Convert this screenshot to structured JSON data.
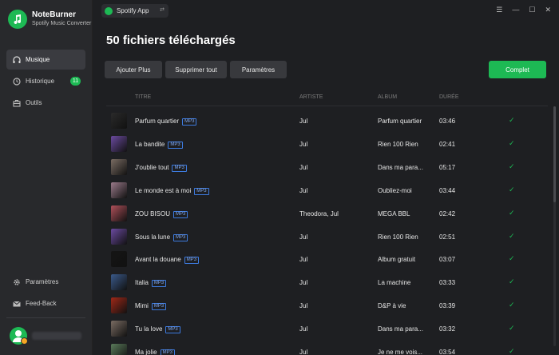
{
  "brand": {
    "name": "NoteBurner",
    "subtitle": "Spotify Music Converter"
  },
  "sidebar": {
    "items": [
      {
        "label": "Musique",
        "icon": "headphones-icon",
        "active": true
      },
      {
        "label": "Historique",
        "icon": "clock-icon",
        "badge": "11"
      },
      {
        "label": "Outils",
        "icon": "toolbox-icon"
      }
    ],
    "bottom": [
      {
        "label": "Paramètres",
        "icon": "gear-icon"
      },
      {
        "label": "Feed-Back",
        "icon": "mail-icon"
      }
    ]
  },
  "app_tab": {
    "label": "Spotify App"
  },
  "title": "50 fichiers téléchargés",
  "toolbar": {
    "add_label": "Ajouter Plus",
    "delete_all_label": "Supprimer tout",
    "settings_label": "Paramètres",
    "complete_label": "Complet"
  },
  "table": {
    "headers": {
      "title": "TITRE",
      "artist": "ARTISTE",
      "album": "ALBUM",
      "duration": "DURÉE"
    },
    "format_badge": "MP3",
    "rows": [
      {
        "title": "Parfum quartier",
        "artist": "Jul",
        "album": "Parfum quartier",
        "duration": "03:46",
        "cover": "#2a2a2a"
      },
      {
        "title": "La bandite",
        "artist": "Jul",
        "album": "Rien 100 Rien",
        "duration": "02:41",
        "cover": "#6b4aa0"
      },
      {
        "title": "J'oublie tout",
        "artist": "Jul",
        "album": "Dans ma para...",
        "duration": "05:17",
        "cover": "#7a6c62"
      },
      {
        "title": "Le monde est à moi",
        "artist": "Jul",
        "album": "Oubliez-moi",
        "duration": "03:44",
        "cover": "#9a7a8a"
      },
      {
        "title": "ZOU BISOU",
        "artist": "Theodora, Jul",
        "album": "MEGA BBL",
        "duration": "02:42",
        "cover": "#b0505a"
      },
      {
        "title": "Sous la lune",
        "artist": "Jul",
        "album": "Rien 100 Rien",
        "duration": "02:51",
        "cover": "#6b4aa0"
      },
      {
        "title": "Avant la douane",
        "artist": "Jul",
        "album": "Album gratuit",
        "duration": "03:07",
        "cover": "#151515"
      },
      {
        "title": "Italia",
        "artist": "Jul",
        "album": "La machine",
        "duration": "03:33",
        "cover": "#3a5a8a"
      },
      {
        "title": "Mimi",
        "artist": "Jul",
        "album": "D&P à vie",
        "duration": "03:39",
        "cover": "#a02818"
      },
      {
        "title": "Tu la love",
        "artist": "Jul",
        "album": "Dans ma para...",
        "duration": "03:32",
        "cover": "#7a6c62"
      },
      {
        "title": "Ma jolie",
        "artist": "Jul",
        "album": "Je ne me vois...",
        "duration": "03:54",
        "cover": "#5a7a5a"
      }
    ]
  },
  "colors": {
    "accent": "#1db954",
    "mp3_badge": "#3d7be0"
  }
}
